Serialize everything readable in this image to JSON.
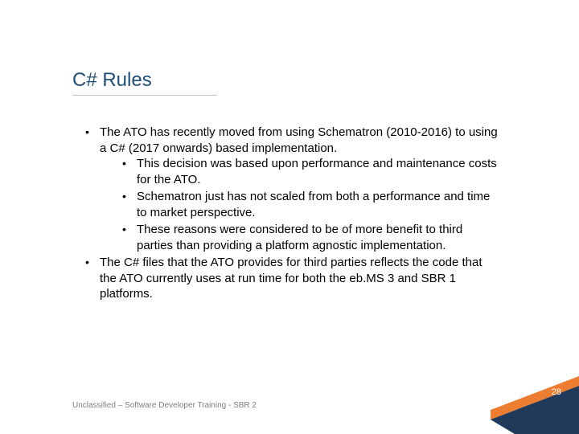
{
  "title": "C# Rules",
  "bullets": {
    "b1": "The ATO has recently moved from using Schematron (2010-2016) to using a C# (2017 onwards) based implementation.",
    "b1a": "This decision was based upon performance and maintenance costs for the ATO.",
    "b1b": "Schematron just has not scaled from both a performance and time to market perspective.",
    "b1c": "These reasons were considered to be of more benefit to third parties than providing a platform agnostic implementation.",
    "b2": "The C# files that the ATO provides for third parties reflects the code that the ATO currently uses at run time for both the eb.MS 3 and SBR 1 platforms."
  },
  "footer": "Unclassified – Software Developer Training - SBR 2",
  "page_number": "28",
  "colors": {
    "orange": "#ed7d31",
    "navy": "#1f3a5a"
  }
}
